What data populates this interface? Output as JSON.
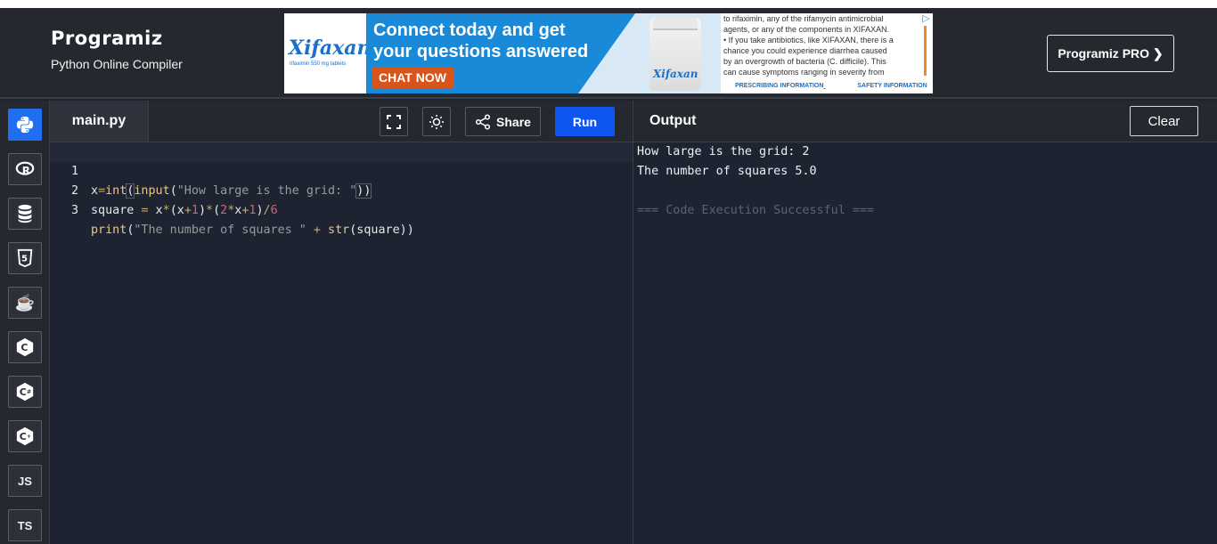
{
  "brand": {
    "logo": "Programiz",
    "subtitle": "Python Online Compiler"
  },
  "ad": {
    "logo": "Xifaxan",
    "logo_sub": "rifaximin 550 mg tablets",
    "headline_1": "Connect today and get",
    "headline_2": "your questions answered",
    "cta": "CHAT NOW",
    "bottle_label": "Xifaxan",
    "text_lines": [
      "to rifaximin, any of the rifamycin antimicrobial",
      "agents, or any of the components in XIFAXAN.",
      "• If you take antibiotics, like XIFAXAN, there is a",
      "chance you could experience diarrhea caused",
      "by an overgrowth of bacteria (C. difficile). This",
      "can cause symptoms ranging in severity from"
    ],
    "link_1": "PRESCRIBING INFORMATION",
    "link_2": "SAFETY INFORMATION",
    "accent": "#1a8ad8",
    "cta_color": "#d9541a"
  },
  "header": {
    "pro_button": "Programiz PRO ❯"
  },
  "sidebar": {
    "items": [
      {
        "name": "python-icon",
        "label": ""
      },
      {
        "name": "r-icon",
        "label": "R"
      },
      {
        "name": "database-icon",
        "label": ""
      },
      {
        "name": "html5-icon",
        "label": "5"
      },
      {
        "name": "java-icon",
        "label": "☕"
      },
      {
        "name": "c-icon",
        "label": "C"
      },
      {
        "name": "csharp-icon",
        "label": "C"
      },
      {
        "name": "cpp-icon",
        "label": "C"
      },
      {
        "name": "js-icon",
        "label": "JS"
      },
      {
        "name": "ts-icon",
        "label": "TS"
      }
    ]
  },
  "editor": {
    "tab": "main.py",
    "share": "Share",
    "run": "Run",
    "lines": [
      {
        "n": "1"
      },
      {
        "n": "2"
      },
      {
        "n": "3"
      }
    ],
    "code": {
      "l1_x": "x",
      "l1_eq": "=",
      "l1_int": "int",
      "l1_p1": "(",
      "l1_input": "input",
      "l1_p2": "(",
      "l1_str": "\"How large is the grid: \"",
      "l1_p3": "))",
      "l2_a": "square ",
      "l2_eq": "=",
      "l2_b": " x",
      "l2_m1": "*",
      "l2_c": "(x",
      "l2_plus1": "+",
      "l2_one1": "1",
      "l2_d": ")",
      "l2_m2": "*",
      "l2_e": "(",
      "l2_two": "2",
      "l2_m3": "*",
      "l2_f": "x",
      "l2_plus2": "+",
      "l2_one2": "1",
      "l2_g": ")",
      "l2_div": "/",
      "l2_six": "6",
      "l3_print": "print",
      "l3_p1": "(",
      "l3_str": "\"The number of squares \"",
      "l3_plus": " + ",
      "l3_str_fn": "str",
      "l3_rest": "(square))"
    }
  },
  "output": {
    "title": "Output",
    "clear": "Clear",
    "lines": [
      "How large is the grid: 2",
      "The number of squares 5.0",
      "",
      "=== Code Execution Successful ==="
    ]
  }
}
